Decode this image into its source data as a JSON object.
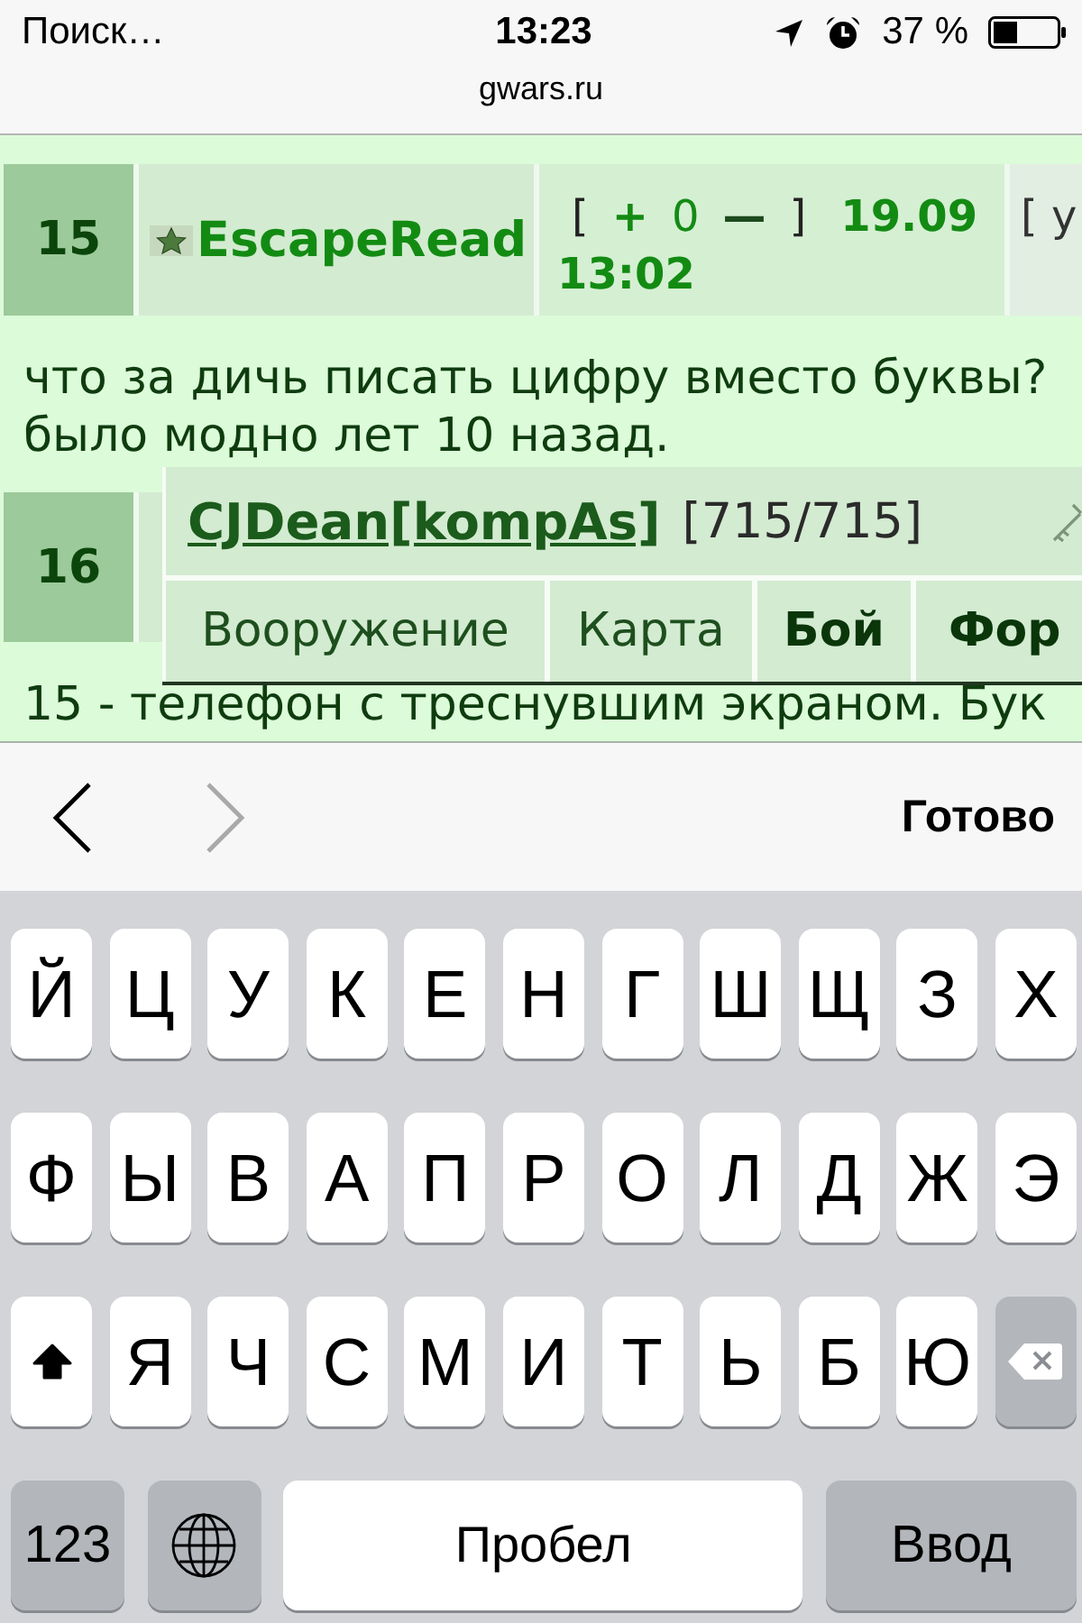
{
  "status_bar": {
    "back_label": "Поиск…",
    "time": "13:23",
    "battery": "37 %"
  },
  "address_bar": {
    "domain": "gwars.ru"
  },
  "forum": {
    "posts": [
      {
        "number": "15",
        "author": "EscapeRead",
        "rating": {
          "open": "[",
          "plus": "+",
          "score": "0",
          "minus": "—",
          "close": "]"
        },
        "date": "19.09",
        "time": "13:02",
        "column_4": "[ у",
        "text": [
          "что за дичь писать цифру вместо буквы?",
          "было модно лет 10 назад."
        ]
      },
      {
        "number": "16",
        "popup": {
          "name": "CJDean[kompAs]",
          "health": "[715/715]",
          "links": [
            {
              "label": "Вооружение",
              "bold": false
            },
            {
              "label": "Карта",
              "bold": false
            },
            {
              "label": "Бой",
              "bold": true
            },
            {
              "label": "Фор",
              "bold": true
            }
          ]
        },
        "text": [
          "15 - телефон с треснувшим экраном. Бук"
        ]
      }
    ]
  },
  "toolbar": {
    "previous": {
      "disabled": false
    },
    "next": {
      "disabled": true
    },
    "done": "Готово"
  },
  "keyboard": {
    "rows": [
      {
        "keys": [
          {
            "kind": "letter",
            "label": "Й"
          },
          {
            "kind": "letter",
            "label": "Ц"
          },
          {
            "kind": "letter",
            "label": "У"
          },
          {
            "kind": "letter",
            "label": "К"
          },
          {
            "kind": "letter",
            "label": "Е"
          },
          {
            "kind": "letter",
            "label": "Н"
          },
          {
            "kind": "letter",
            "label": "Г"
          },
          {
            "kind": "letter",
            "label": "Ш"
          },
          {
            "kind": "letter",
            "label": "Щ"
          },
          {
            "kind": "letter",
            "label": "З"
          },
          {
            "kind": "letter",
            "label": "Х"
          }
        ]
      },
      {
        "keys": [
          {
            "kind": "letter",
            "label": "Ф"
          },
          {
            "kind": "letter",
            "label": "Ы"
          },
          {
            "kind": "letter",
            "label": "В"
          },
          {
            "kind": "letter",
            "label": "А"
          },
          {
            "kind": "letter",
            "label": "П"
          },
          {
            "kind": "letter",
            "label": "Р"
          },
          {
            "kind": "letter",
            "label": "О"
          },
          {
            "kind": "letter",
            "label": "Л"
          },
          {
            "kind": "letter",
            "label": "Д"
          },
          {
            "kind": "letter",
            "label": "Ж"
          },
          {
            "kind": "letter",
            "label": "Э"
          }
        ]
      },
      {
        "keys": [
          {
            "kind": "shift",
            "on": true
          },
          {
            "kind": "letter",
            "label": "Я"
          },
          {
            "kind": "letter",
            "label": "Ч"
          },
          {
            "kind": "letter",
            "label": "С"
          },
          {
            "kind": "letter",
            "label": "М"
          },
          {
            "kind": "letter",
            "label": "И"
          },
          {
            "kind": "letter",
            "label": "Т"
          },
          {
            "kind": "letter",
            "label": "Ь"
          },
          {
            "kind": "letter",
            "label": "Б"
          },
          {
            "kind": "letter",
            "label": "Ю"
          },
          {
            "kind": "delete"
          }
        ]
      },
      {
        "keys": [
          {
            "kind": "numbers",
            "label": "123"
          },
          {
            "kind": "globe"
          },
          {
            "kind": "space",
            "label": "Пробел"
          },
          {
            "kind": "return",
            "label": "Ввод"
          }
        ]
      }
    ]
  }
}
